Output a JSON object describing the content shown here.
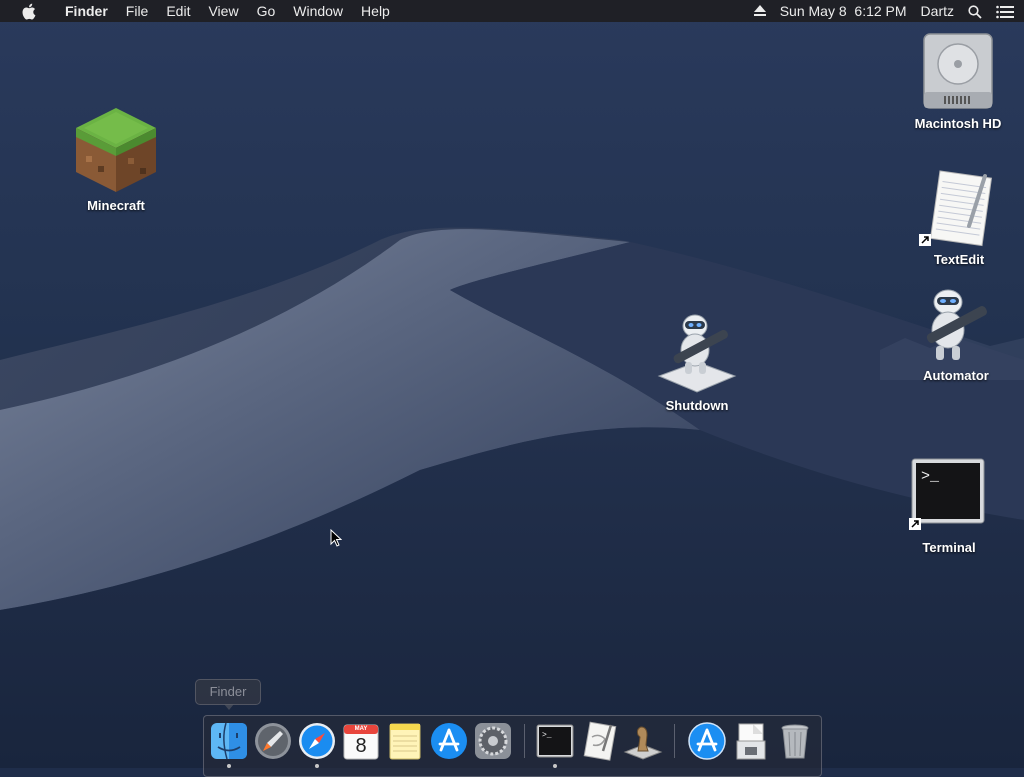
{
  "menubar": {
    "app_name": "Finder",
    "menus": [
      "File",
      "Edit",
      "View",
      "Go",
      "Window",
      "Help"
    ],
    "clock": "Sun May 8  6:12 PM",
    "user": "Dartz",
    "icons": [
      "apple-icon",
      "eject-icon",
      "spotlight-search-icon",
      "notification-center-icon"
    ]
  },
  "desktop": {
    "icons": [
      {
        "label": "Minecraft",
        "icon": "minecraft-grass-block-icon"
      },
      {
        "label": "Macintosh HD",
        "icon": "hard-drive-icon"
      },
      {
        "label": "TextEdit",
        "icon": "textedit-icon",
        "alias": true
      },
      {
        "label": "Automator",
        "icon": "automator-robot-icon"
      },
      {
        "label": "Shutdown",
        "icon": "automator-workflow-icon"
      },
      {
        "label": "Terminal",
        "icon": "terminal-icon",
        "alias": true
      }
    ]
  },
  "dock": {
    "tooltip": "Finder",
    "calendar_month": "MAY",
    "calendar_day": "8",
    "items": [
      {
        "name": "Finder",
        "icon": "finder-icon",
        "running": true
      },
      {
        "name": "Launchpad",
        "icon": "launchpad-icon",
        "running": false
      },
      {
        "name": "Safari",
        "icon": "safari-icon",
        "running": true
      },
      {
        "name": "Calendar",
        "icon": "calendar-icon",
        "running": false
      },
      {
        "name": "Notes",
        "icon": "notes-icon",
        "running": false
      },
      {
        "name": "App Store",
        "icon": "app-store-icon",
        "running": false
      },
      {
        "name": "System Preferences",
        "icon": "system-preferences-icon",
        "running": false
      },
      {
        "name": "Terminal",
        "icon": "terminal-icon",
        "running": true
      },
      {
        "name": "Script Editor",
        "icon": "script-editor-icon",
        "running": false
      },
      {
        "name": "Chess",
        "icon": "chess-icon",
        "running": false
      },
      {
        "name": "Applications",
        "icon": "applications-folder-icon",
        "running": false
      },
      {
        "name": "Documents",
        "icon": "documents-stack-icon",
        "running": false
      },
      {
        "name": "Trash",
        "icon": "trash-icon",
        "running": false
      }
    ]
  },
  "colors": {
    "menubar_bg": "#1e1e22",
    "wallpaper_sky": "#1f2d4a",
    "dune": "#6b7790"
  }
}
